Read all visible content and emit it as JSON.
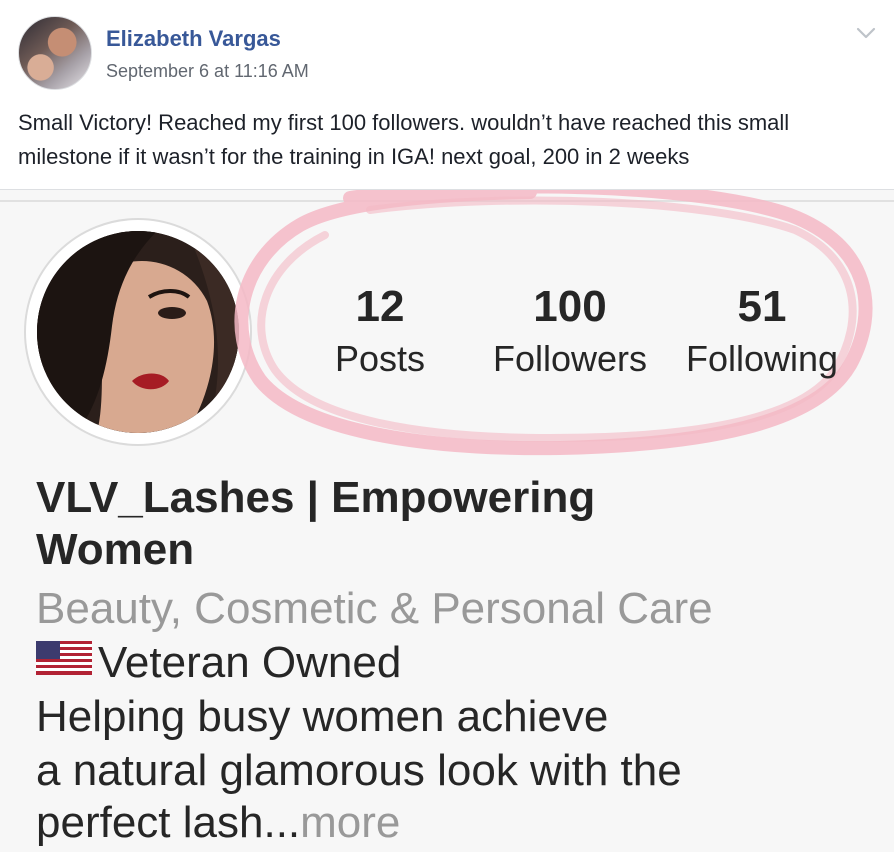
{
  "post": {
    "author": "Elizabeth Vargas",
    "timestamp": "September 6 at 11:16 AM",
    "text": "Small Victory! Reached my first 100 followers. wouldn’t have reached this small milestone if it wasn’t for the training in IGA! next goal, 200 in 2 weeks",
    "menu_icon": "chevron-down-icon"
  },
  "instagram": {
    "stats": [
      {
        "value": "12",
        "label": "Posts"
      },
      {
        "value": "100",
        "label": "Followers"
      },
      {
        "value": "51",
        "label": "Following"
      }
    ],
    "name": "VLV_Lashes | Empowering Women",
    "category": "Beauty, Cosmetic & Personal Care",
    "bio": {
      "line1": "Veteran Owned",
      "line1_icon": "us-flag-icon",
      "line2": "Helping busy women achieve",
      "line3": "a natural glamorous look with the",
      "line4": "perfect lash",
      "ellipsis": "...",
      "more": "more"
    }
  },
  "colors": {
    "author_link": "#385898",
    "scribble": "#f4b9c5",
    "muted_text": "#999999"
  }
}
